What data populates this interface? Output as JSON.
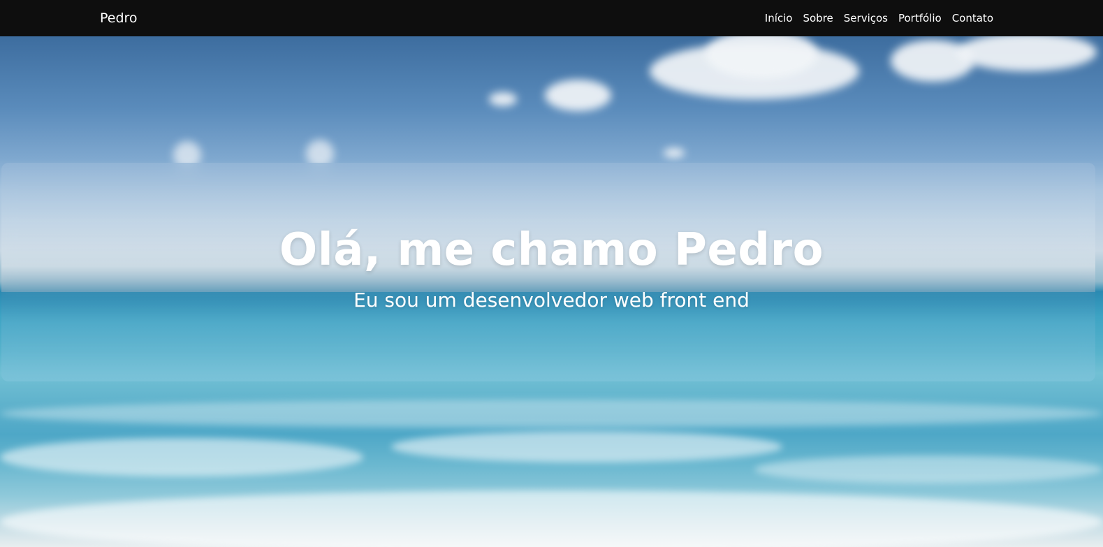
{
  "navbar": {
    "brand": "Pedro",
    "links": [
      {
        "label": "Início"
      },
      {
        "label": "Sobre"
      },
      {
        "label": "Serviços"
      },
      {
        "label": "Portfólio"
      },
      {
        "label": "Contato"
      }
    ]
  },
  "hero": {
    "title": "Olá, me chamo Pedro",
    "subtitle": "Eu sou um desenvolvedor web front end",
    "background": "beach-ocean-photo"
  },
  "colors": {
    "navbar_bg": "#0e0e0e",
    "text": "#ffffff"
  }
}
